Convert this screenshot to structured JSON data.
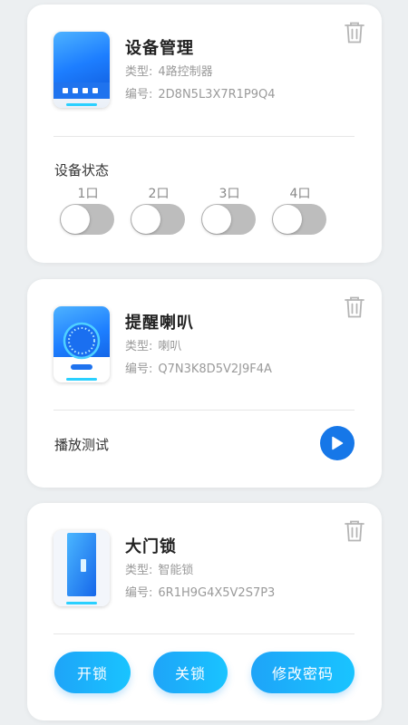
{
  "colors": {
    "accent": "#1677e8",
    "pill_gradient_start": "#1ea4f8",
    "pill_gradient_end": "#19c4ff",
    "toggle_off": "#bdbdbd"
  },
  "devices": [
    {
      "name": "设备管理",
      "type_label": "类型:",
      "type_value": "4路控制器",
      "id_label": "编号:",
      "id_value": "2D8N5L3X7R1P9Q4",
      "icon": "controller-icon",
      "status_label": "设备状态",
      "ports": [
        {
          "label": "1口",
          "on": false
        },
        {
          "label": "2口",
          "on": false
        },
        {
          "label": "3口",
          "on": false
        },
        {
          "label": "4口",
          "on": false
        }
      ]
    },
    {
      "name": "提醒喇叭",
      "type_label": "类型:",
      "type_value": "喇叭",
      "id_label": "编号:",
      "id_value": "Q7N3K8D5V2J9F4A",
      "icon": "speaker-icon",
      "action_label": "播放测试"
    },
    {
      "name": "大门锁",
      "type_label": "类型:",
      "type_value": "智能锁",
      "id_label": "编号:",
      "id_value": "6R1H9G4X5V2S7P3",
      "icon": "door-lock-icon",
      "buttons": [
        "开锁",
        "关锁",
        "修改密码"
      ]
    }
  ]
}
